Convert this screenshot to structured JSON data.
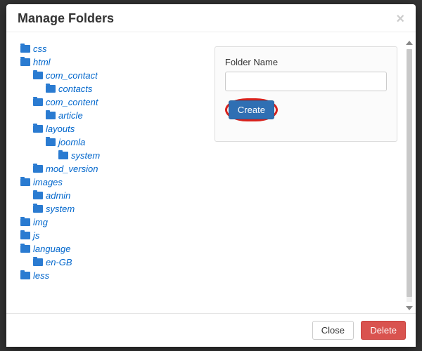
{
  "modal": {
    "title": "Manage Folders",
    "close_x": "×"
  },
  "tree": [
    {
      "label": "css",
      "children": []
    },
    {
      "label": "html",
      "children": [
        {
          "label": "com_contact",
          "children": [
            {
              "label": "contacts",
              "children": []
            }
          ]
        },
        {
          "label": "com_content",
          "children": [
            {
              "label": "article",
              "children": []
            }
          ]
        },
        {
          "label": "layouts",
          "children": [
            {
              "label": "joomla",
              "children": [
                {
                  "label": "system",
                  "children": []
                }
              ]
            }
          ]
        },
        {
          "label": "mod_version",
          "children": []
        }
      ]
    },
    {
      "label": "images",
      "children": [
        {
          "label": "admin",
          "children": []
        },
        {
          "label": "system",
          "children": []
        }
      ]
    },
    {
      "label": "img",
      "children": []
    },
    {
      "label": "js",
      "children": []
    },
    {
      "label": "language",
      "children": [
        {
          "label": "en-GB",
          "children": []
        }
      ]
    },
    {
      "label": "less",
      "children": []
    }
  ],
  "form": {
    "label": "Folder Name",
    "input_value": "",
    "create_button": "Create"
  },
  "footer": {
    "close": "Close",
    "delete": "Delete"
  }
}
